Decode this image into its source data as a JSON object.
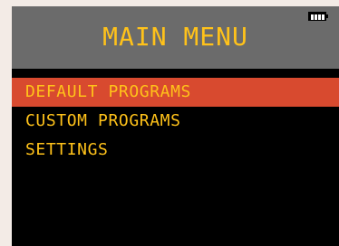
{
  "header": {
    "title": "MAIN MENU"
  },
  "status": {
    "battery_icon": "battery-full-icon"
  },
  "menu": {
    "items": [
      {
        "label": "DEFAULT PROGRAMS",
        "selected": true
      },
      {
        "label": "CUSTOM PROGRAMS",
        "selected": false
      },
      {
        "label": "SETTINGS",
        "selected": false
      }
    ]
  },
  "colors": {
    "accent_text": "#ffc21a",
    "selection_bg": "#d84a2f",
    "header_bg": "#6b6b6b",
    "screen_bg": "#000000"
  }
}
